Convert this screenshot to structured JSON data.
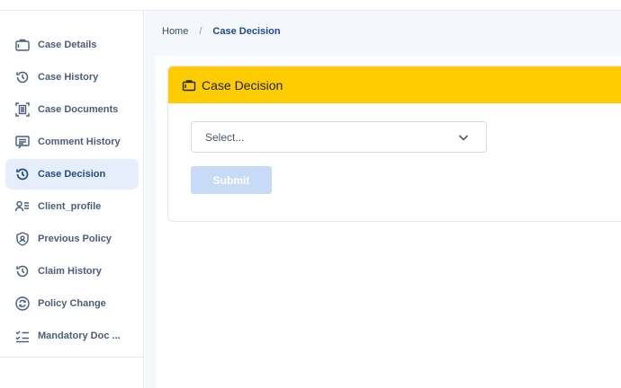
{
  "sidebar": {
    "items": [
      {
        "label": "Case Details",
        "icon": "briefcase-icon",
        "active": false
      },
      {
        "label": "Case History",
        "icon": "history-icon",
        "active": false
      },
      {
        "label": "Case Documents",
        "icon": "document-scan-icon",
        "active": false
      },
      {
        "label": "Comment History",
        "icon": "comment-icon",
        "active": false
      },
      {
        "label": "Case Decision",
        "icon": "history-icon",
        "active": true
      },
      {
        "label": "Client_profile",
        "icon": "user-list-icon",
        "active": false
      },
      {
        "label": "Previous Policy",
        "icon": "shield-user-icon",
        "active": false
      },
      {
        "label": "Claim History",
        "icon": "history-icon",
        "active": false
      },
      {
        "label": "Policy Change",
        "icon": "refresh-circle-icon",
        "active": false
      },
      {
        "label": "Mandatory Doc ...",
        "icon": "checklist-icon",
        "active": false
      }
    ]
  },
  "breadcrumb": {
    "home": "Home",
    "separator": "/",
    "current": "Case Decision"
  },
  "card": {
    "title": "Case Decision",
    "icon": "briefcase-icon"
  },
  "form": {
    "select_placeholder": "Select...",
    "submit_label": "Submit"
  },
  "colors": {
    "header_yellow": "#ffcc00",
    "active_bg": "#e6eefb",
    "submit_disabled": "#c7daf6",
    "accent_blue": "#1f4a8a"
  }
}
